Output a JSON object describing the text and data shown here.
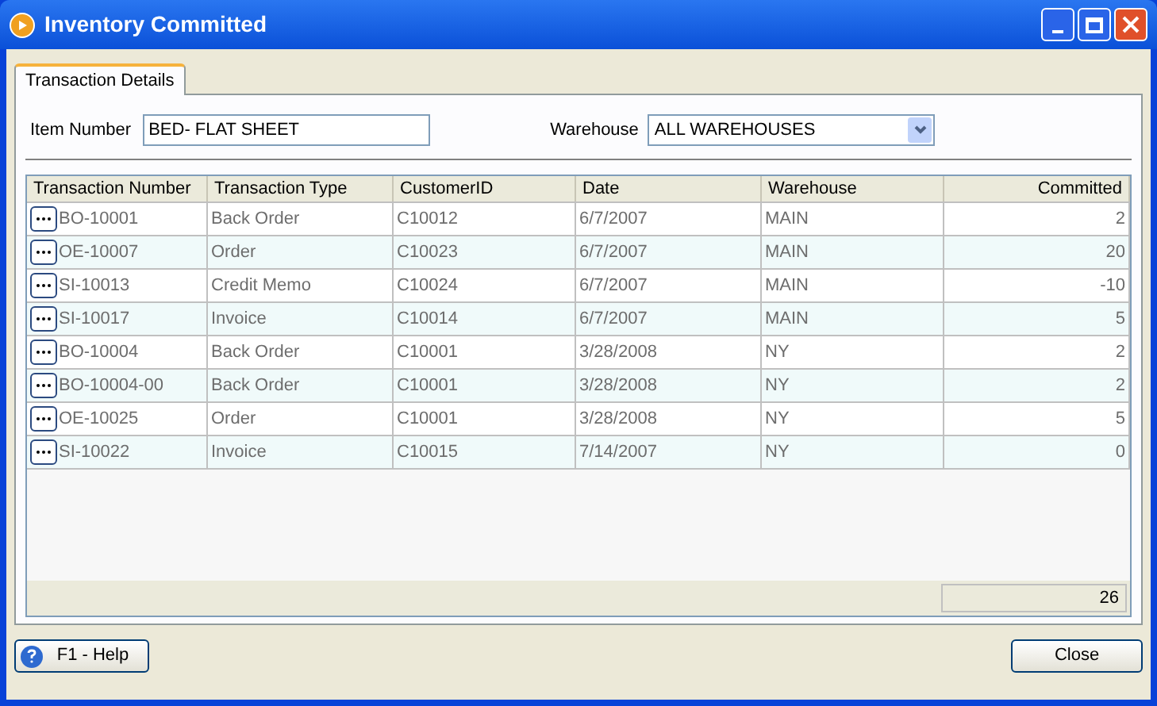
{
  "window": {
    "title": "Inventory Committed"
  },
  "tabs": [
    {
      "label": "Transaction Details",
      "selected": true
    }
  ],
  "item_number": {
    "label": "Item Number",
    "value": "BED- FLAT SHEET"
  },
  "warehouse": {
    "label": "Warehouse",
    "value": "ALL WAREHOUSES"
  },
  "table": {
    "columns": [
      "Transaction Number",
      "Transaction Type",
      "CustomerID",
      "Date",
      "Warehouse",
      "Committed"
    ],
    "rows": [
      [
        "BO-10001",
        "Back Order",
        "C10012",
        "6/7/2007",
        "MAIN",
        "2"
      ],
      [
        "OE-10007",
        "Order",
        "C10023",
        "6/7/2007",
        "MAIN",
        "20"
      ],
      [
        "SI-10013",
        "Credit Memo",
        "C10024",
        "6/7/2007",
        "MAIN",
        "-10"
      ],
      [
        "SI-10017",
        "Invoice",
        "C10014",
        "6/7/2007",
        "MAIN",
        "5"
      ],
      [
        "BO-10004",
        "Back Order",
        "C10001",
        "3/28/2008",
        "NY",
        "2"
      ],
      [
        "BO-10004-00",
        "Back Order",
        "C10001",
        "3/28/2008",
        "NY",
        "2"
      ],
      [
        "OE-10025",
        "Order",
        "C10001",
        "3/28/2008",
        "NY",
        "5"
      ],
      [
        "SI-10022",
        "Invoice",
        "C10015",
        "7/14/2007",
        "NY",
        "0"
      ]
    ],
    "total": "26"
  },
  "buttons": {
    "help": "F1 - Help",
    "close": "Close"
  }
}
